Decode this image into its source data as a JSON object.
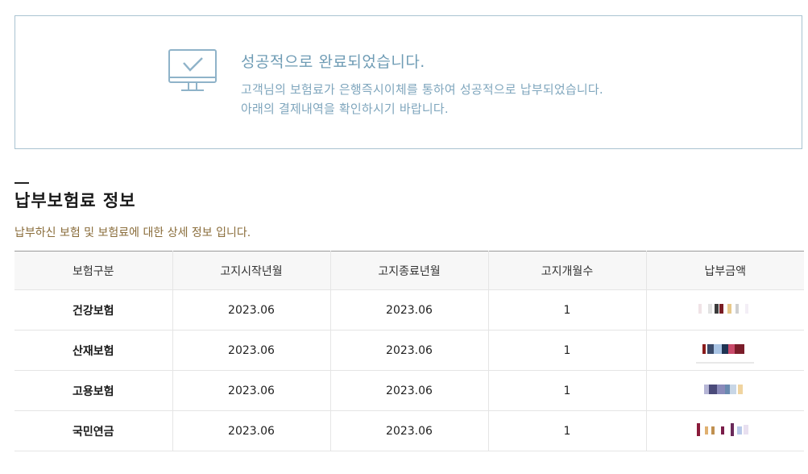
{
  "banner": {
    "title": "성공적으로 완료되었습니다.",
    "line1": "고객님의 보험료가 은행즉시이체를 통하여 성공적으로 납부되었습니다.",
    "line2": "아래의 결제내역을 확인하시기 바랍니다.",
    "icon": "monitor-check-icon"
  },
  "section": {
    "title": "납부보험료 정보",
    "subtitle": "납부하신 보험 및 보험료에 대한 상세 정보 입니다."
  },
  "table": {
    "headers": [
      "보험구분",
      "고지시작년월",
      "고지종료년월",
      "고지개월수",
      "납부금액"
    ],
    "rows": [
      {
        "type": "건강보험",
        "start": "2023.06",
        "end": "2023.06",
        "months": "1"
      },
      {
        "type": "산재보험",
        "start": "2023.06",
        "end": "2023.06",
        "months": "1"
      },
      {
        "type": "고용보험",
        "start": "2023.06",
        "end": "2023.06",
        "months": "1"
      },
      {
        "type": "국민연금",
        "start": "2023.06",
        "end": "2023.06",
        "months": "1"
      }
    ]
  },
  "colors": {
    "banner_border": "#a9c3d1",
    "banner_text": "#6f9cb5",
    "subtitle_text": "#8a6d3b"
  }
}
